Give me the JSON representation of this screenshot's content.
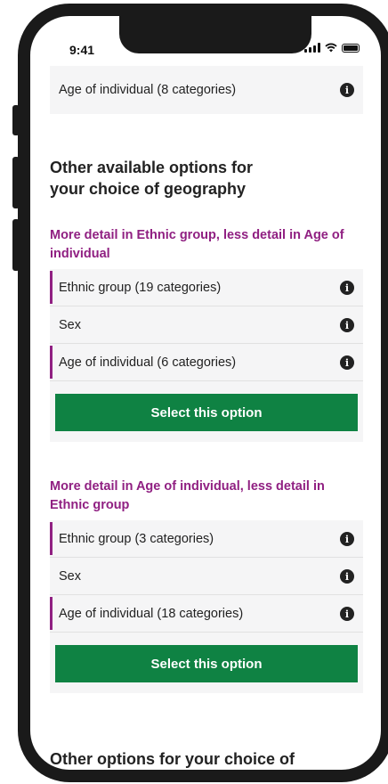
{
  "status_bar": {
    "time": "9:41"
  },
  "previous_card": {
    "rows": [
      {
        "label": "Age of individual (8 categories)"
      }
    ]
  },
  "section_heading": "Other available options for your choice of geography",
  "options": [
    {
      "heading": "More detail in Ethnic group, less detail in Age of individual",
      "rows": [
        {
          "label": "Ethnic group (19 categories)"
        },
        {
          "label": "Sex"
        },
        {
          "label": "Age of individual (6 categories)"
        }
      ],
      "button_label": "Select this option"
    },
    {
      "heading": "More detail in Age of individual, less detail in Ethnic group",
      "rows": [
        {
          "label": "Ethnic group (3 categories)"
        },
        {
          "label": "Sex"
        },
        {
          "label": "Age of individual (18 categories)"
        }
      ],
      "button_label": "Select this option"
    }
  ],
  "bottom_heading": "Other options for your choice of geography that have some",
  "icons": {
    "info": "info-icon",
    "signal": "signal-icon",
    "wifi": "wifi-icon",
    "battery": "battery-icon"
  },
  "colors": {
    "accent_purple": "#902082",
    "button_green": "#0f8243",
    "card_background": "#f5f5f6"
  }
}
